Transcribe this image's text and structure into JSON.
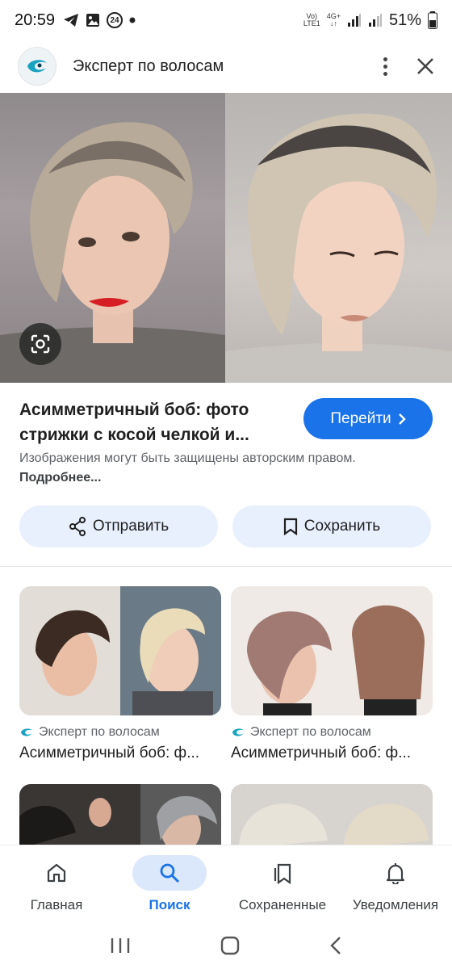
{
  "status_bar": {
    "time": "20:59",
    "notification_count": "24",
    "network_top": "Vo)",
    "network_bottom": "LTE1",
    "network_type": "4G+",
    "battery": "51%"
  },
  "header": {
    "title": "Эксперт по волосам",
    "logo_icon": "hair-expert-logo-icon",
    "menu_icon": "more-vert-icon",
    "close_icon": "close-icon"
  },
  "result": {
    "title": "Асимметричный боб: фото стрижки с косой челкой и...",
    "go_button": "Перейти",
    "copyright_text": "Изображения могут быть защищены авторским правом.",
    "more_link": "Подробнее..."
  },
  "actions": {
    "share": "Отправить",
    "save": "Сохранить"
  },
  "related": [
    {
      "source": "Эксперт по волосам",
      "title": "Асимметричный боб: ф..."
    },
    {
      "source": "Эксперт по волосам",
      "title": "Асимметричный боб: ф..."
    }
  ],
  "bottom_nav": {
    "items": [
      {
        "label": "Главная",
        "icon": "home-icon"
      },
      {
        "label": "Поиск",
        "icon": "search-icon"
      },
      {
        "label": "Сохраненные",
        "icon": "bookmarks-icon"
      },
      {
        "label": "Уведомления",
        "icon": "bell-icon"
      }
    ],
    "active_index": 1
  },
  "colors": {
    "accent": "#1a73e8",
    "tonal_button": "#e8f0fe",
    "active_nav_pill": "#dbe7fb"
  }
}
